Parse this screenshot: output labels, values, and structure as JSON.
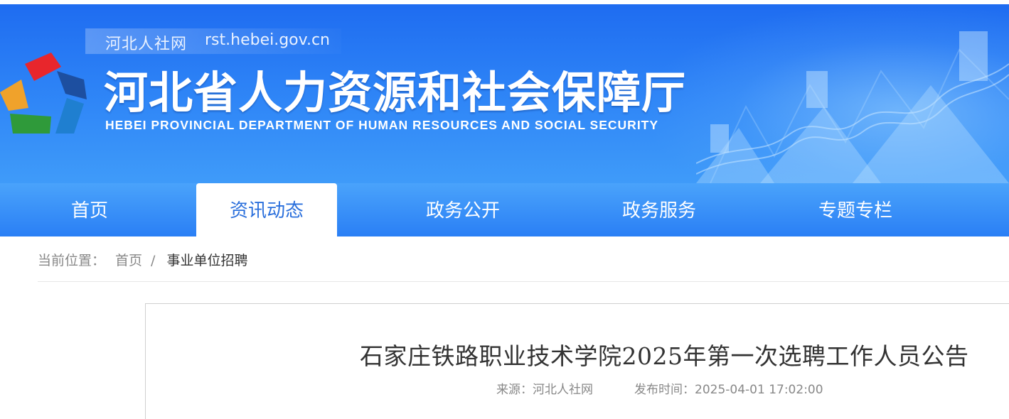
{
  "header": {
    "site_name": "河北人社网",
    "site_url": "rst.hebei.gov.cn",
    "dept_title": "河北省人力资源和社会保障厅",
    "dept_title_en": "HEBEI PROVINCIAL DEPARTMENT OF HUMAN RESOURCES AND SOCIAL SECURITY",
    "logo_colors": [
      "#e8262c",
      "#1d4fa0",
      "#1f7fd0",
      "#2f9a3a",
      "#f0a22b"
    ]
  },
  "nav": {
    "items": [
      {
        "label": "首页"
      },
      {
        "label": "资讯动态"
      },
      {
        "label": "政务公开"
      },
      {
        "label": "政务服务"
      },
      {
        "label": "专题专栏"
      }
    ],
    "active": "资讯动态"
  },
  "breadcrumb": {
    "label": "当前位置：",
    "home": "首页",
    "separator": "/",
    "current": "事业单位招聘"
  },
  "article": {
    "title": "石家庄铁路职业技术学院2025年第一次选聘工作人员公告",
    "source": "来源：河北人社网",
    "published": "发布时间：2025-04-01 17:02:00"
  },
  "colors": {
    "brand_blue": "#2a7ff5",
    "active_text": "#2a6fdc"
  }
}
